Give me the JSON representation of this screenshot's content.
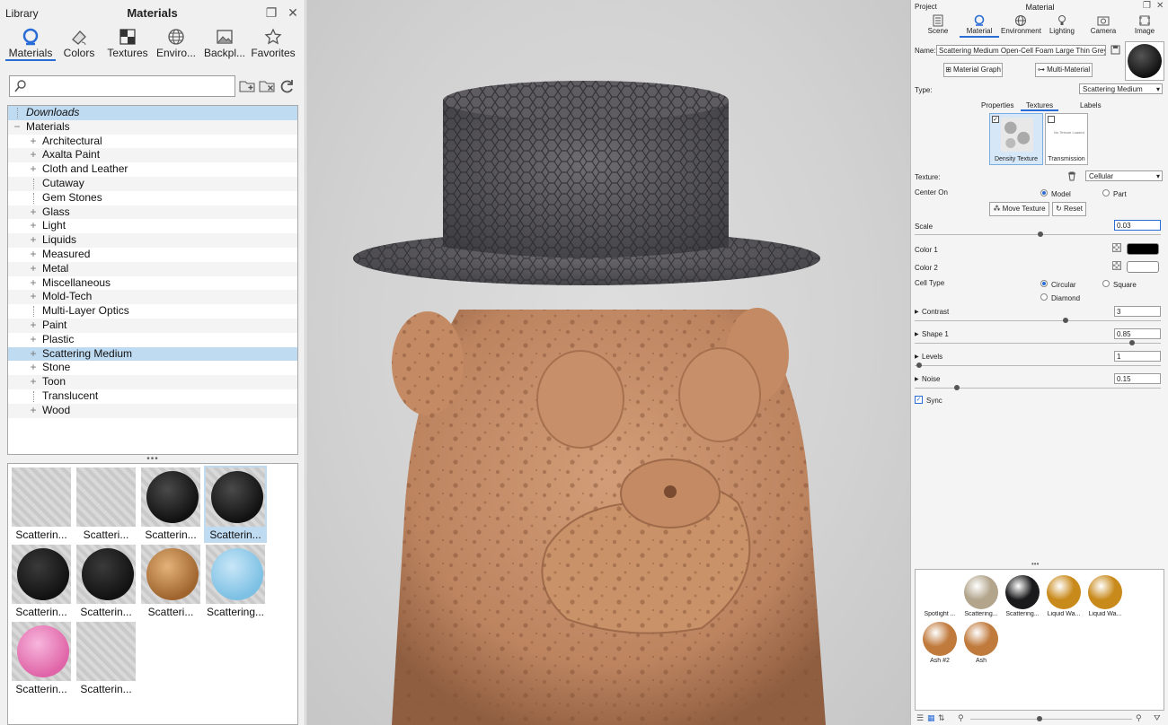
{
  "library": {
    "panel_title": "Library",
    "heading": "Materials",
    "tabs": [
      {
        "label": "Materials",
        "icon": "materials-icon"
      },
      {
        "label": "Colors",
        "icon": "colors-icon"
      },
      {
        "label": "Textures",
        "icon": "textures-icon"
      },
      {
        "label": "Enviro...",
        "icon": "environment-icon"
      },
      {
        "label": "Backpl...",
        "icon": "backplate-icon"
      },
      {
        "label": "Favorites",
        "icon": "favorites-icon"
      }
    ],
    "search": {
      "value": "",
      "placeholder": ""
    },
    "tree": [
      {
        "label": "Downloads",
        "level": 0,
        "expander": "",
        "selected": true,
        "italic": true
      },
      {
        "label": "Materials",
        "level": 0,
        "expander": "−"
      },
      {
        "label": "Architectural",
        "level": 1,
        "expander": "+"
      },
      {
        "label": "Axalta Paint",
        "level": 1,
        "expander": "+"
      },
      {
        "label": "Cloth and Leather",
        "level": 1,
        "expander": "+"
      },
      {
        "label": "Cutaway",
        "level": 1,
        "expander": ""
      },
      {
        "label": "Gem Stones",
        "level": 1,
        "expander": ""
      },
      {
        "label": "Glass",
        "level": 1,
        "expander": "+"
      },
      {
        "label": "Light",
        "level": 1,
        "expander": "+"
      },
      {
        "label": "Liquids",
        "level": 1,
        "expander": "+"
      },
      {
        "label": "Measured",
        "level": 1,
        "expander": "+"
      },
      {
        "label": "Metal",
        "level": 1,
        "expander": "+"
      },
      {
        "label": "Miscellaneous",
        "level": 1,
        "expander": "+"
      },
      {
        "label": "Mold-Tech",
        "level": 1,
        "expander": "+"
      },
      {
        "label": "Multi-Layer Optics",
        "level": 1,
        "expander": ""
      },
      {
        "label": "Paint",
        "level": 1,
        "expander": "+"
      },
      {
        "label": "Plastic",
        "level": 1,
        "expander": "+"
      },
      {
        "label": "Scattering Medium",
        "level": 1,
        "expander": "+",
        "selected": true
      },
      {
        "label": "Stone",
        "level": 1,
        "expander": "+"
      },
      {
        "label": "Toon",
        "level": 1,
        "expander": "+"
      },
      {
        "label": "Translucent",
        "level": 1,
        "expander": ""
      },
      {
        "label": "Wood",
        "level": 1,
        "expander": "+"
      }
    ],
    "splitter": "•••",
    "thumbnails": [
      {
        "label": "Scatterin...",
        "style": "floor"
      },
      {
        "label": "Scatteri...",
        "style": "floor"
      },
      {
        "label": "Scatterin...",
        "style": "black-ball"
      },
      {
        "label": "Scatterin...",
        "style": "black-ball",
        "selected": true
      },
      {
        "label": "Scatterin...",
        "style": "dark-ball"
      },
      {
        "label": "Scatterin...",
        "style": "dark-ball"
      },
      {
        "label": "Scatteri...",
        "style": "amber-ball"
      },
      {
        "label": "Scattering...",
        "style": "blue-ball"
      },
      {
        "label": "Scatterin...",
        "style": "pink-ball"
      },
      {
        "label": "Scatterin...",
        "style": "floor"
      }
    ]
  },
  "project": {
    "panel_left": "Project",
    "panel_title": "Material",
    "tabs": [
      {
        "label": "Scene",
        "icon": "scene-icon"
      },
      {
        "label": "Material",
        "icon": "material-icon"
      },
      {
        "label": "Environment",
        "icon": "environment-icon"
      },
      {
        "label": "Lighting",
        "icon": "lighting-icon"
      },
      {
        "label": "Camera",
        "icon": "camera-icon"
      },
      {
        "label": "Image",
        "icon": "image-icon"
      }
    ],
    "name_label": "Name:",
    "name_value": "Scattering Medium Open-Cell Foam Large Thin Grey",
    "material_graph": "Material Graph",
    "multi_material": "Multi-Material",
    "type_label": "Type:",
    "type_value": "Scattering Medium",
    "subtabs": [
      "Properties",
      "Textures",
      "Labels"
    ],
    "density_texture": "Density Texture",
    "transmission": "Transmission",
    "no_texture": "No Texture Loaded",
    "texture_label": "Texture:",
    "texture_value": "Cellular",
    "center_on_label": "Center On",
    "center_on_options": [
      "Model",
      "Part"
    ],
    "move_texture": "Move Texture",
    "reset": "Reset",
    "scale_label": "Scale",
    "scale_value": "0.03",
    "color1_label": "Color 1",
    "color2_label": "Color 2",
    "color1": "#000000",
    "color2": "#ffffff",
    "cell_type_label": "Cell Type",
    "cell_type_options": [
      "Circular",
      "Square",
      "Diamond"
    ],
    "contrast_label": "Contrast",
    "contrast_value": "3",
    "shape1_label": "Shape 1",
    "shape1_value": "0.85",
    "levels_label": "Levels",
    "levels_value": "1",
    "noise_label": "Noise",
    "noise_value": "0.15",
    "sync_label": "Sync",
    "splitter": "•••",
    "materials": [
      {
        "label": "Spotlight ...",
        "color": "#ffffff"
      },
      {
        "label": "Scattering...",
        "color": "#b3a58c"
      },
      {
        "label": "Scattering...",
        "color": "#1a1a1c"
      },
      {
        "label": "Liquid Wa...",
        "color": "#c98a1c"
      },
      {
        "label": "Liquid Wa...",
        "color": "#c98a1c"
      },
      {
        "label": "Ash #2",
        "color": "#c07a3c"
      },
      {
        "label": "Ash",
        "color": "#c07a3c"
      }
    ]
  },
  "colors": {
    "accent": "#2a6cd6",
    "selection": "#bfdbf2"
  }
}
